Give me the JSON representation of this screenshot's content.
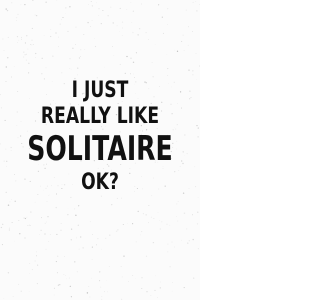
{
  "cover": {
    "title_lines": [
      "I JUST",
      "REALLY LIKE",
      "SOLITAIRE",
      "OK?"
    ]
  }
}
